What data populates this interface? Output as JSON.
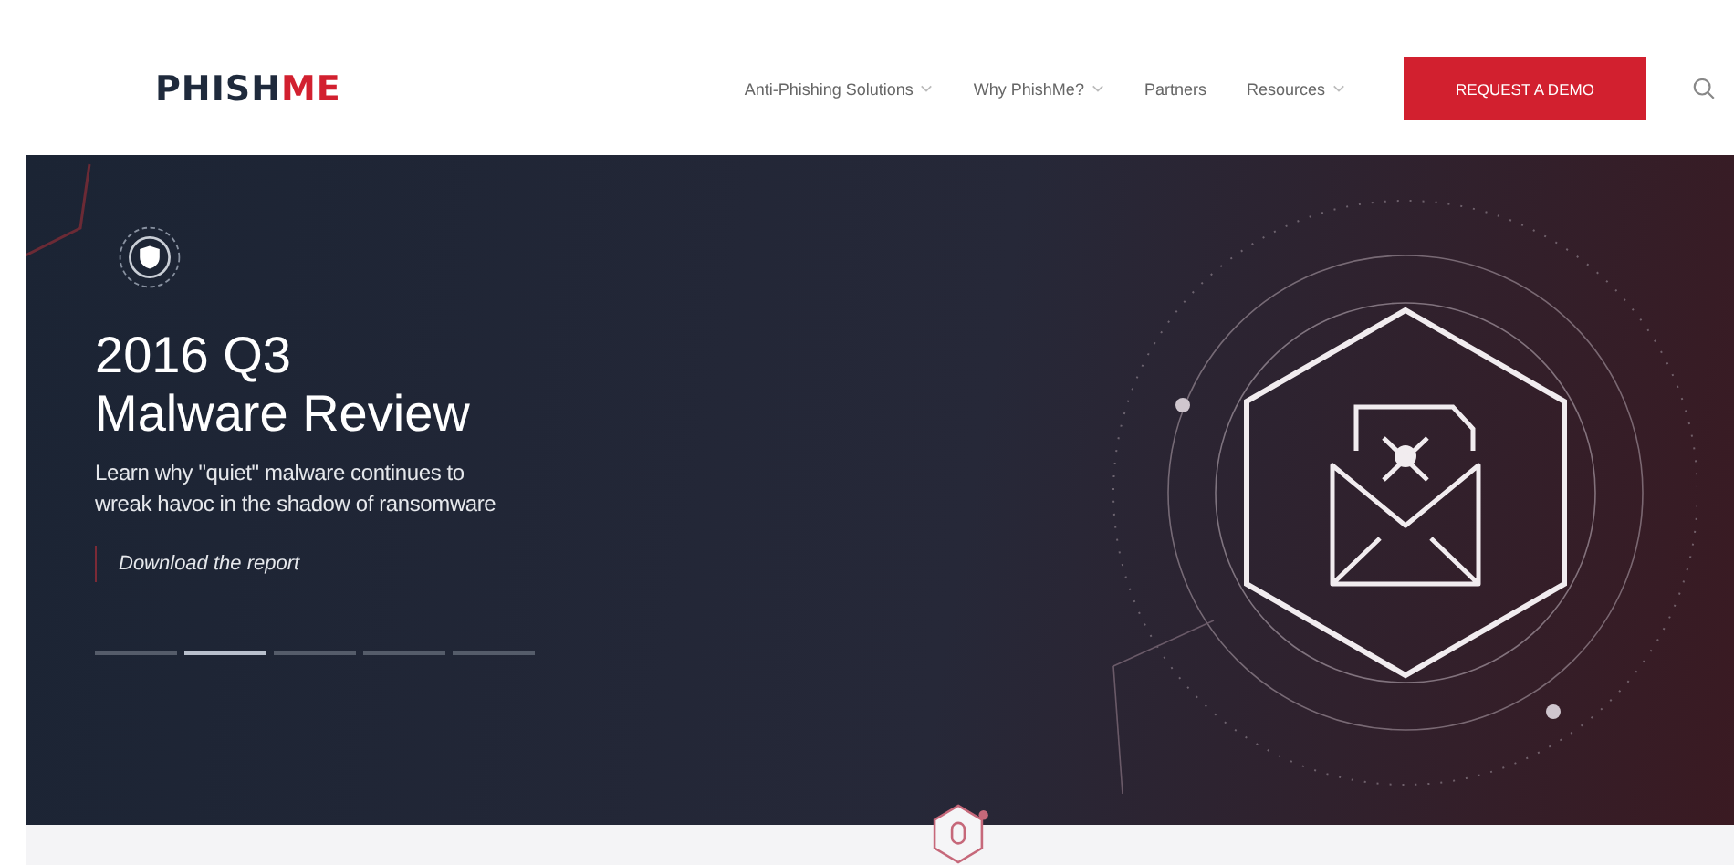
{
  "header": {
    "logo": {
      "text": "PHISH",
      "accent": "ME"
    },
    "nav": [
      {
        "label": "Anti-Phishing Solutions",
        "has_menu": true
      },
      {
        "label": "Why PhishMe?",
        "has_menu": true
      },
      {
        "label": "Partners",
        "has_menu": false
      },
      {
        "label": "Resources",
        "has_menu": true
      }
    ],
    "cta": "REQUEST A DEMO"
  },
  "hero": {
    "title_line1": "2016 Q3",
    "title_line2": "Malware Review",
    "subtitle": "Learn why \"quiet\" malware continues to wreak havoc in the shadow of ransomware",
    "link": "Download the report",
    "slides": [
      {
        "selected": false
      },
      {
        "selected": true
      },
      {
        "selected": false
      },
      {
        "selected": false
      },
      {
        "selected": false
      }
    ]
  }
}
